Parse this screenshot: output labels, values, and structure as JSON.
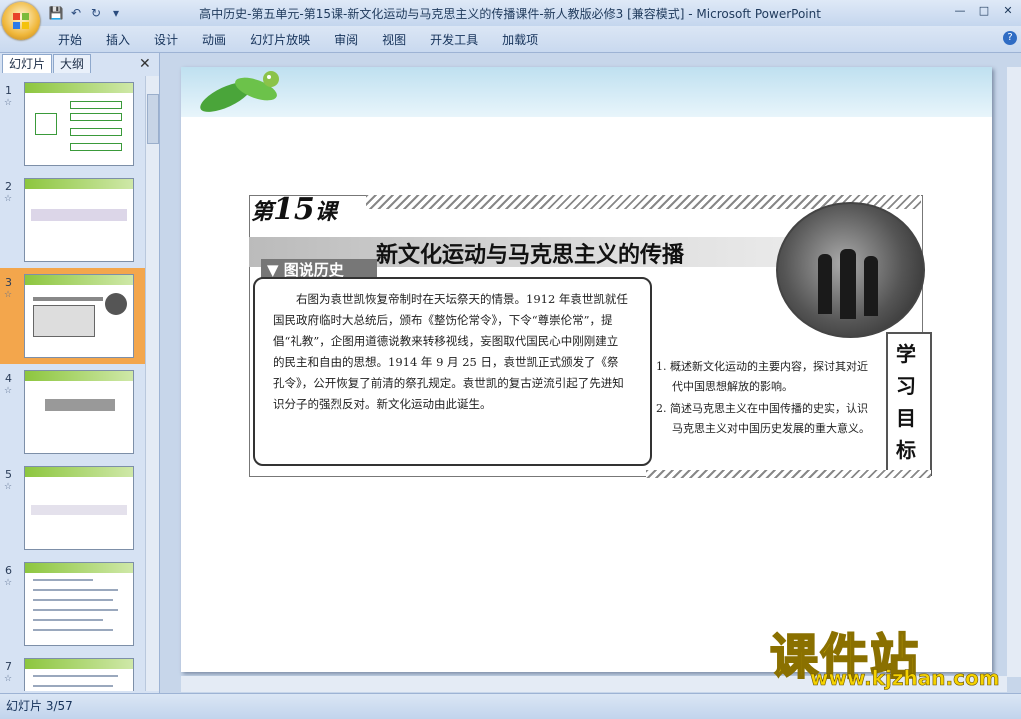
{
  "window": {
    "title": "高中历史-第五单元-第15课-新文化运动与马克思主义的传播课件-新人教版必修3 [兼容模式] - Microsoft PowerPoint"
  },
  "ribbon": {
    "tabs": [
      "开始",
      "插入",
      "设计",
      "动画",
      "幻灯片放映",
      "审阅",
      "视图",
      "开发工具",
      "加载项"
    ]
  },
  "left_pane": {
    "tabs": [
      "幻灯片",
      "大纲"
    ],
    "slides": [
      {
        "num": "1"
      },
      {
        "num": "2"
      },
      {
        "num": "3",
        "selected": true
      },
      {
        "num": "4"
      },
      {
        "num": "5"
      },
      {
        "num": "6"
      },
      {
        "num": "7"
      }
    ]
  },
  "slide": {
    "lesson_prefix": "第",
    "lesson_number": "15",
    "lesson_suffix": "课",
    "title": "新文化运动与马克思主义的传播",
    "picture_tag": "图说历史",
    "description": "右图为袁世凯恢复帝制时在天坛祭天的情景。1912 年袁世凯就任国民政府临时大总统后，颁布《整饬伦常令》，下令“尊崇伦常”，提倡“礼教”，企图用道德说教来转移视线，妄图取代国民心中刚刚建立的民主和自由的思想。1914 年 9 月 25 日，袁世凯正式颁发了《祭孔令》，公开恢复了前清的祭孔规定。袁世凯的复古逆流引起了先进知识分子的强烈反对。新文化运动由此诞生。",
    "goal_label": [
      "学",
      "习",
      "目",
      "标"
    ],
    "goals": [
      "1. 概述新文化运动的主要内容，探讨其对近代中国思想解放的影响。",
      "2. 简述马克思主义在中国传播的史实，认识马克思主义对中国历史发展的重大意义。"
    ]
  },
  "watermark": {
    "text": "课件站",
    "url": "www.kjzhan.com"
  },
  "status": {
    "slide_counter": "幻灯片 3/57"
  }
}
